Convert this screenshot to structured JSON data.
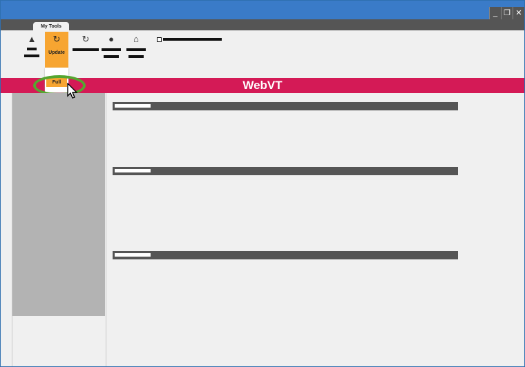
{
  "window": {
    "controls": [
      "_",
      "❐",
      "✕"
    ]
  },
  "tabs": {
    "active_label": "My Tools"
  },
  "toolbar": {
    "update_label": "Update",
    "update_icon": "refresh-icon"
  },
  "dropdown": {
    "full_label": "Full"
  },
  "header": {
    "title": "WebVT",
    "band_color": "#d41a56"
  },
  "colors": {
    "accent": "#f7a531",
    "titlebar": "#3a7bc8",
    "highlight": "#55a630"
  }
}
